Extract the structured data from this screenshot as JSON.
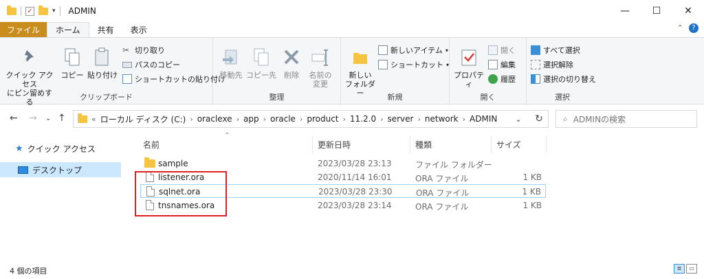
{
  "titlebar": {
    "title": "ADMIN",
    "minimize": "—",
    "maximize": "☐",
    "close": "✕"
  },
  "tabs": [
    {
      "label": "ファイル"
    },
    {
      "label": "ホーム"
    },
    {
      "label": "共有"
    },
    {
      "label": "表示"
    }
  ],
  "ribbon": {
    "clipboard": {
      "label": "クリップボード",
      "pin_line1": "クイック アクセス",
      "pin_line2": "にピン留めする",
      "copy": "コピー",
      "paste": "貼り付け",
      "cut": "切り取り",
      "copy_path": "パスのコピー",
      "paste_shortcut": "ショートカットの貼り付け"
    },
    "organize": {
      "label": "整理",
      "move_to": "移動先",
      "copy_to": "コピー先",
      "delete": "削除",
      "rename_line1": "名前の",
      "rename_line2": "変更"
    },
    "new": {
      "label": "新規",
      "new_folder_line1": "新しい",
      "new_folder_line2": "フォルダー",
      "new_item": "新しいアイテム",
      "shortcut": "ショートカット"
    },
    "open": {
      "label": "開く",
      "properties": "プロパティ",
      "open": "開く",
      "edit": "編集",
      "history": "履歴"
    },
    "select": {
      "label": "選択",
      "select_all": "すべて選択",
      "select_none": "選択解除",
      "invert": "選択の切り替え"
    }
  },
  "address": {
    "crumbs": [
      "ローカル ディスク (C:)",
      "oraclexe",
      "app",
      "oracle",
      "product",
      "11.2.0",
      "server",
      "network",
      "ADMIN"
    ],
    "search_placeholder": "ADMINの検索"
  },
  "nav": {
    "quick_access": "クイック アクセス",
    "desktop": "デスクトップ"
  },
  "columns": {
    "name": "名前",
    "modified": "更新日時",
    "type": "種類",
    "size": "サイズ"
  },
  "files": [
    {
      "name": "sample",
      "modified": "2023/03/28 23:13",
      "type": "ファイル フォルダー",
      "size": ""
    },
    {
      "name": "listener.ora",
      "modified": "2020/11/14 16:01",
      "type": "ORA ファイル",
      "size": "1 KB"
    },
    {
      "name": "sqlnet.ora",
      "modified": "2023/03/28 23:30",
      "type": "ORA ファイル",
      "size": "1 KB"
    },
    {
      "name": "tnsnames.ora",
      "modified": "2023/03/28 23:14",
      "type": "ORA ファイル",
      "size": "1 KB"
    }
  ],
  "status": {
    "count": "4 個の項目"
  },
  "colors": {
    "file_tab": "#c98d1e",
    "folder": "#f5c542",
    "selection": "#cce8ff",
    "highlight": "#e02020"
  }
}
